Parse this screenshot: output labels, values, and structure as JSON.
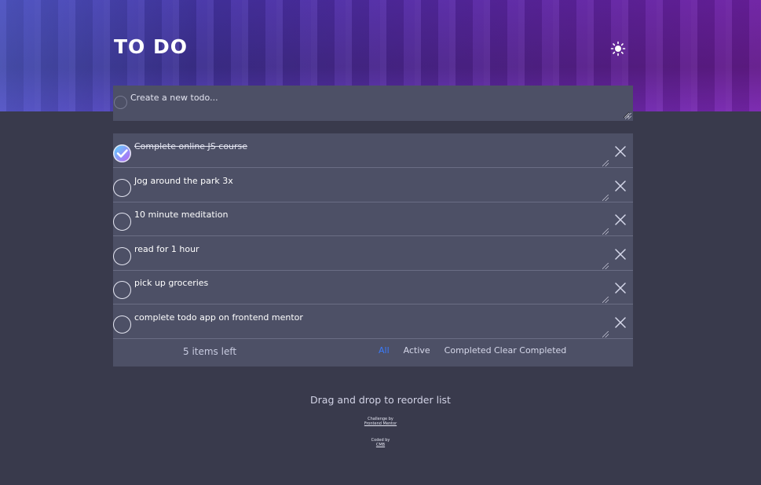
{
  "header": {
    "title": "TO DO",
    "theme_icon": "sun-icon"
  },
  "new_todo": {
    "placeholder": "Create a new todo..."
  },
  "todos": [
    {
      "text": "Complete online JS course",
      "completed": true
    },
    {
      "text": "Jog around the park 3x",
      "completed": false
    },
    {
      "text": "10 minute meditation",
      "completed": false
    },
    {
      "text": "read for 1 hour",
      "completed": false
    },
    {
      "text": "pick up groceries",
      "completed": false
    },
    {
      "text": "complete todo app on frontend mentor",
      "completed": false
    }
  ],
  "footer": {
    "items_left": "5 items left",
    "filters": [
      "All",
      "Active",
      "Completed"
    ],
    "active_filter": "All",
    "clear_completed": "Clear Completed"
  },
  "hint": "Drag and drop to reorder list",
  "attribution": {
    "challenge_by": "Challenge by",
    "challenge_link": "Frontend Mentor",
    "coded_by": "Coded by",
    "coder_link": "CMB"
  },
  "colors": {
    "background": "#393a4c",
    "panel": "#4d5066",
    "accent": "#3a7bfd",
    "check_gradient_start": "#57ddff",
    "check_gradient_end": "#c058f3"
  }
}
